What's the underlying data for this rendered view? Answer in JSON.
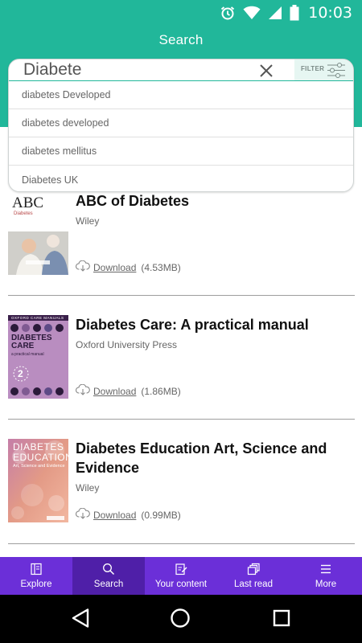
{
  "status_bar": {
    "time": "10:03",
    "icons": [
      "alarm-icon",
      "wifi-icon",
      "signal-icon",
      "battery-icon"
    ]
  },
  "header": {
    "title": "Search"
  },
  "search": {
    "query": "Diabete",
    "filter_label": "FILTER",
    "suggestions": [
      "diabetes Developed",
      "diabetes developed",
      "diabetes mellitus",
      "Diabetes UK"
    ]
  },
  "books": [
    {
      "title": "ABC of Diabetes",
      "publisher": "Wiley",
      "download_label": "Download",
      "size": "(4.53MB)",
      "cover": {
        "heading": "ABC",
        "sub": "Diabetes"
      }
    },
    {
      "title": "Diabetes Care: A practical manual",
      "publisher": "Oxford University Press",
      "download_label": "Download",
      "size": "(1.86MB)",
      "cover": {
        "series": "OXFORD CARE MANUALS",
        "heading1": "DIABETES",
        "heading2": "CARE",
        "sub": "a practical manual",
        "edition": "2"
      }
    },
    {
      "title": "Diabetes Education Art, Science and Evidence",
      "publisher": "Wiley",
      "download_label": "Download",
      "size": "(0.99MB)",
      "cover": {
        "heading1": "DIABETES",
        "heading2": "EDUCATION",
        "sub": "Art, Science and Evidence"
      }
    }
  ],
  "bottom_nav": [
    {
      "label": "Explore",
      "icon": "book-icon",
      "active": false
    },
    {
      "label": "Search",
      "icon": "search-icon",
      "active": true
    },
    {
      "label": "Your content",
      "icon": "edit-note-icon",
      "active": false
    },
    {
      "label": "Last read",
      "icon": "stacked-pages-icon",
      "active": false
    },
    {
      "label": "More",
      "icon": "menu-icon",
      "active": false
    }
  ],
  "system_nav": [
    "back-icon",
    "home-icon",
    "recents-icon"
  ],
  "colors": {
    "header": "#21b79a",
    "nav": "#6b2fd8",
    "nav_active": "#4f1fa8"
  }
}
